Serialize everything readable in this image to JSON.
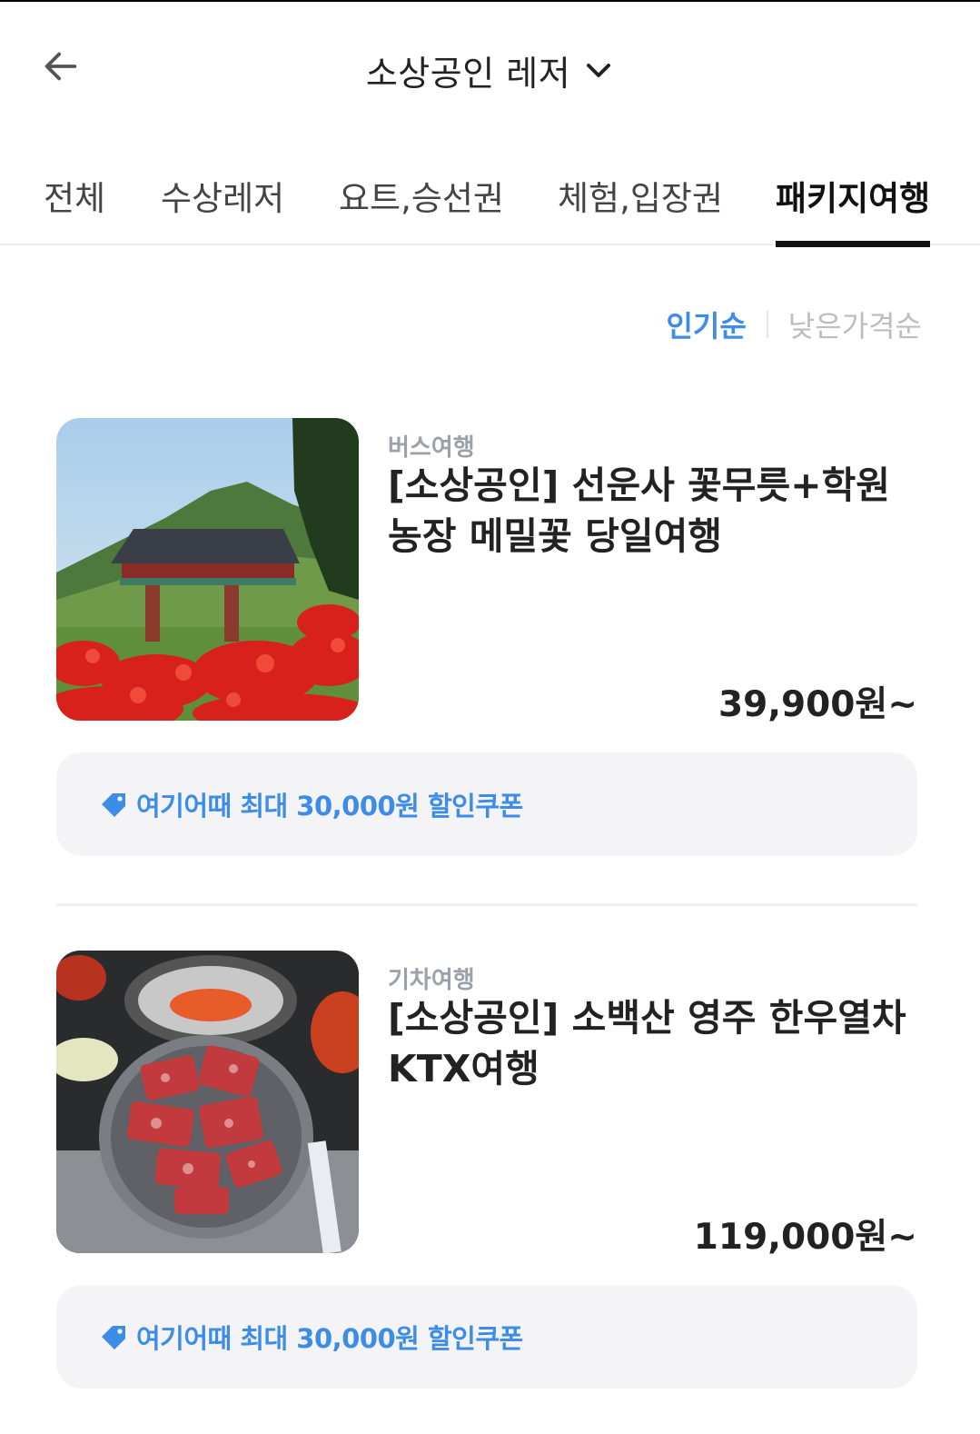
{
  "header": {
    "title": "소상공인 레저",
    "back_icon": "arrow-left-icon",
    "dropdown_icon": "chevron-down-icon"
  },
  "tabs": [
    {
      "label": "전체",
      "active": false
    },
    {
      "label": "수상레저",
      "active": false
    },
    {
      "label": "요트,승선권",
      "active": false
    },
    {
      "label": "체험,입장권",
      "active": false
    },
    {
      "label": "패키지여행",
      "active": true
    }
  ],
  "sort": {
    "popular": "인기순",
    "low_price": "낮은가격순",
    "selected": "인기순"
  },
  "products": [
    {
      "category": "버스여행",
      "name": "[소상공인] 선운사 꽃무릇+학원 농장 메밀꽃 당일여행",
      "price": "39,900원~",
      "image": "temple-gate-red-flowers",
      "coupon": "여기어때 최대 30,000원 할인쿠폰"
    },
    {
      "category": "기차여행",
      "name": "[소상공인] 소백산 영주 한우열차 KTX여행",
      "price": "119,000원~",
      "image": "korean-beef-grill",
      "coupon": "여기어때 최대 30,000원 할인쿠폰"
    }
  ],
  "colors": {
    "accent": "#3d8ce8",
    "coupon_bg": "#f4f4f6",
    "muted": "#9aa1a8"
  }
}
